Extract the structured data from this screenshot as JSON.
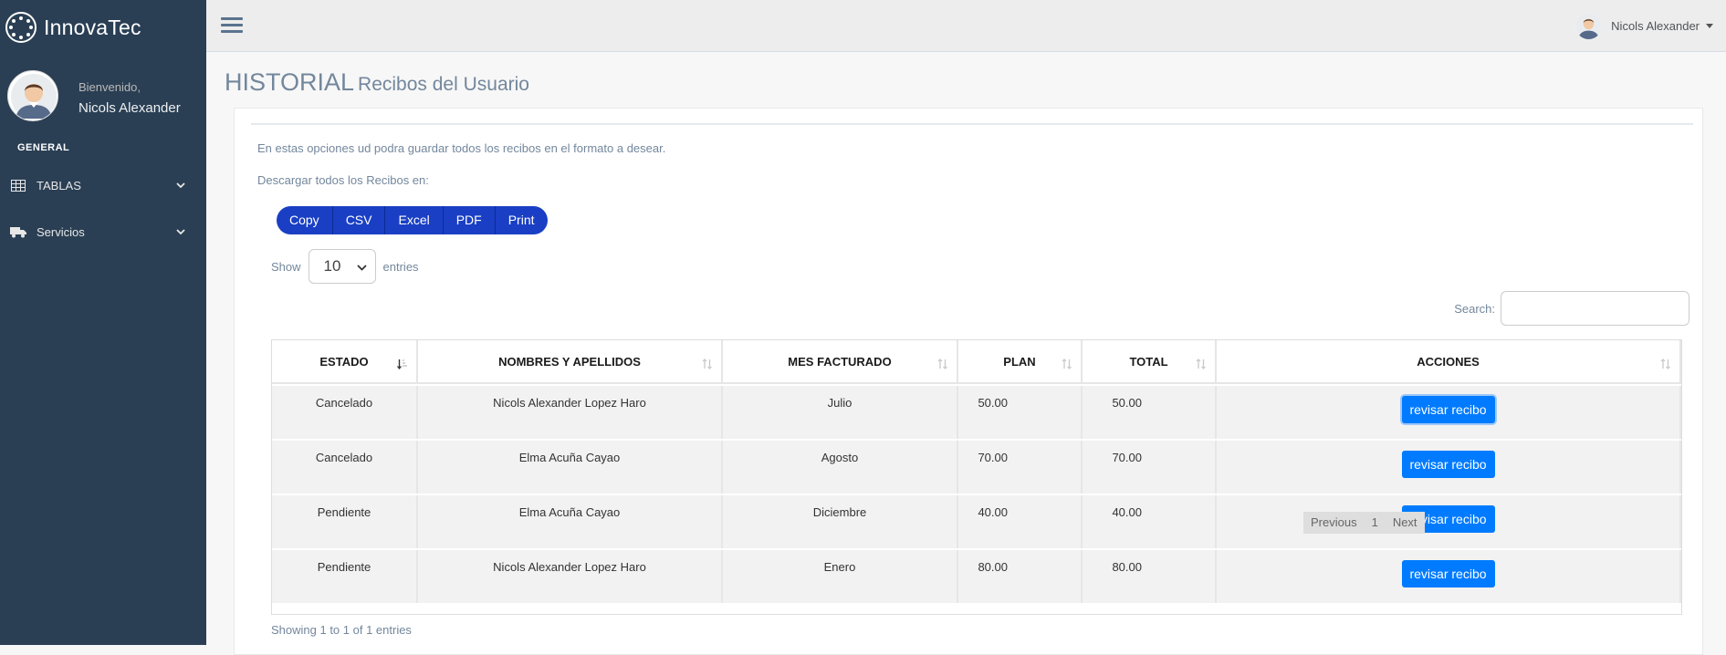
{
  "sidebar": {
    "brand": "InnovaTec",
    "welcome": "Bienvenido,",
    "username": "Nicols Alexander",
    "section_title": "GENERAL",
    "items": [
      {
        "label": "TABLAS",
        "icon": "table-icon"
      },
      {
        "label": "Servicios",
        "icon": "truck-icon"
      }
    ]
  },
  "header": {
    "user_name": "Nicols Alexander"
  },
  "page": {
    "title": "HISTORIAL",
    "subtitle": "Recibos del Usuario"
  },
  "panel": {
    "intro": "En estas opciones ud podra guardar todos los recibos en el formato a desear.",
    "download_label": "Descargar todos los Recibos en:",
    "export_buttons": [
      "Copy",
      "CSV",
      "Excel",
      "PDF",
      "Print"
    ],
    "show_label": "Show",
    "entries_value": "10",
    "entries_label": "entries",
    "search_label": "Search:",
    "search_value": ""
  },
  "table": {
    "columns": [
      "ESTADO",
      "NOMBRES Y APELLIDOS",
      "MES FACTURADO",
      "PLAN",
      "TOTAL",
      "ACCIONES"
    ],
    "rows": [
      {
        "estado": "Cancelado",
        "nombre": "Nicols Alexander Lopez Haro",
        "mes": "Julio",
        "plan": "50.00",
        "total": "50.00",
        "accion": "revisar recibo"
      },
      {
        "estado": "Cancelado",
        "nombre": "Elma Acuña Cayao",
        "mes": "Agosto",
        "plan": "70.00",
        "total": "70.00",
        "accion": "revisar recibo"
      },
      {
        "estado": "Pendiente",
        "nombre": "Elma Acuña Cayao",
        "mes": "Diciembre",
        "plan": "40.00",
        "total": "40.00",
        "accion": "revisar recibo"
      },
      {
        "estado": "Pendiente",
        "nombre": "Nicols Alexander Lopez Haro",
        "mes": "Enero",
        "plan": "80.00",
        "total": "80.00",
        "accion": "revisar recibo"
      }
    ]
  },
  "footer": {
    "info": "Showing 1 to 1 of 1 entries",
    "previous": "Previous",
    "page": "1",
    "next": "Next"
  }
}
